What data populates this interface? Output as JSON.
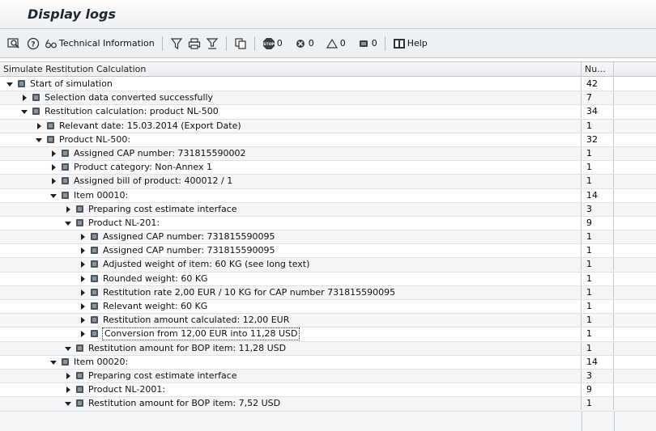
{
  "window": {
    "title": "Display logs"
  },
  "toolbar": {
    "technical_info_label": "Technical Information",
    "stop_count": "0",
    "error_count": "0",
    "warning_count": "0",
    "info_count": "0",
    "help_label": "Help"
  },
  "grid": {
    "col_text": "Simulate Restitution Calculation",
    "col_num": "Nu...",
    "rows": [
      {
        "level": 0,
        "expanded": true,
        "text": "Start of simulation",
        "num": "42"
      },
      {
        "level": 1,
        "expanded": false,
        "text": "Selection data converted successfully",
        "num": "7"
      },
      {
        "level": 1,
        "expanded": true,
        "text": "Restitution calculation: product NL-500",
        "num": "34"
      },
      {
        "level": 2,
        "expanded": false,
        "text": "Relevant date: 15.03.2014 (Export Date)",
        "num": "1"
      },
      {
        "level": 2,
        "expanded": true,
        "text": "Product NL-500:",
        "num": "32"
      },
      {
        "level": 3,
        "expanded": false,
        "text": "Assigned CAP number: 731815590002",
        "num": "1"
      },
      {
        "level": 3,
        "expanded": false,
        "text": "Product category: Non-Annex 1",
        "num": "1"
      },
      {
        "level": 3,
        "expanded": false,
        "text": "Assigned bill of product: 400012 / 1",
        "num": "1"
      },
      {
        "level": 3,
        "expanded": true,
        "text": "Item 00010:",
        "num": "14"
      },
      {
        "level": 4,
        "expanded": false,
        "text": "Preparing cost estimate interface",
        "num": "3"
      },
      {
        "level": 4,
        "expanded": true,
        "text": "Product NL-201:",
        "num": "9"
      },
      {
        "level": 5,
        "expanded": false,
        "text": "Assigned CAP number: 731815590095",
        "num": "1"
      },
      {
        "level": 5,
        "expanded": false,
        "text": "Assigned CAP number: 731815590095",
        "num": "1"
      },
      {
        "level": 5,
        "expanded": false,
        "text": "Adjusted weight of item: 60 KG (see long text)",
        "num": "1"
      },
      {
        "level": 5,
        "expanded": false,
        "text": "Rounded weight: 60 KG",
        "num": "1"
      },
      {
        "level": 5,
        "expanded": false,
        "text": "Restitution rate 2,00 EUR / 10 KG for CAP number 731815590095",
        "num": "1"
      },
      {
        "level": 5,
        "expanded": false,
        "text": "Relevant weight: 60 KG",
        "num": "1"
      },
      {
        "level": 5,
        "expanded": false,
        "text": "Restitution amount calculated: 12,00 EUR",
        "num": "1"
      },
      {
        "level": 5,
        "expanded": false,
        "text": "Conversion from 12,00 EUR into 11,28 USD",
        "num": "1",
        "focused": true
      },
      {
        "level": 4,
        "expanded": true,
        "text": "Restitution amount for BOP item: 11,28 USD",
        "num": "1"
      },
      {
        "level": 3,
        "expanded": true,
        "text": "Item 00020:",
        "num": "14"
      },
      {
        "level": 4,
        "expanded": false,
        "text": "Preparing cost estimate interface",
        "num": "3"
      },
      {
        "level": 4,
        "expanded": false,
        "text": "Product NL-2001:",
        "num": "9"
      },
      {
        "level": 4,
        "expanded": true,
        "text": "Restitution amount for BOP item: 7,52 USD",
        "num": "1"
      }
    ]
  }
}
